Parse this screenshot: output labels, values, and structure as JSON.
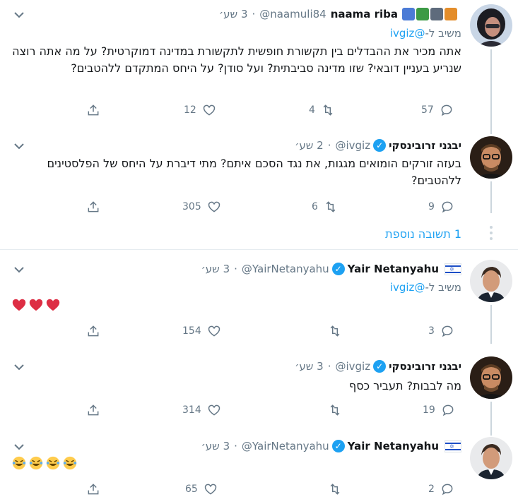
{
  "tweets": [
    {
      "name": "naama riba",
      "handle": "@naamuli84",
      "time": "3 שע׳",
      "reply_prefix": "משיב ל-",
      "reply_mention": "@ivgiz",
      "text": "אתה מכיר את ההבדלים בין תקשורת חופשית לתקשורת במדינה דמוקרטית? על מה אתה רוצה שנריע בעניין דובאי? שזו מדינה סביבתית? ועל סודן? על היחס המתקדם ללהטבים?",
      "replies": "57",
      "retweets": "4",
      "likes": "12"
    },
    {
      "name": "יבגני זרובינסקי",
      "handle": "@ivgiz",
      "time": "2 שע׳",
      "text": "בעזה זורקים הומואים מגגות, את נגד הסכם איתם? מתי דיברת על היחס של הפלסטינים ללהטבים?",
      "replies": "9",
      "retweets": "6",
      "likes": "305"
    },
    {
      "name": "Yair Netanyahu",
      "handle": "@YairNetanyahu",
      "time": "3 שע׳",
      "reply_prefix": "משיב ל-",
      "reply_mention": "@ivgiz",
      "text_emoji": "❤❤❤",
      "replies": "3",
      "retweets": "",
      "likes": "154"
    },
    {
      "name": "יבגני זרובינסקי",
      "handle": "@ivgiz",
      "time": "3 שע׳",
      "text": "מה לבבות? תעביר כסף",
      "replies": "19",
      "retweets": "",
      "likes": "314"
    },
    {
      "name": "Yair Netanyahu",
      "handle": "@YairNetanyahu",
      "time": "3 שע׳",
      "text_emoji": "🤣🤣🤣🤣",
      "replies": "2",
      "retweets": "",
      "likes": "65"
    }
  ],
  "more_replies": "1 תשובה נוספת",
  "colors": {
    "accent": "#1da1f2",
    "muted": "#657786",
    "line": "#ccd6dd",
    "heart": "#e0245e"
  }
}
